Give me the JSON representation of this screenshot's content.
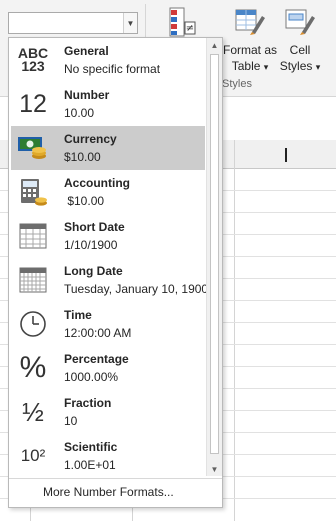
{
  "ribbon": {
    "format_combo_value": "",
    "format_as_table": {
      "line1": "Format as",
      "line2": "Table",
      "caret": "▾"
    },
    "cell_styles": {
      "line1": "Cell",
      "line2": "Styles",
      "caret": "▾"
    },
    "group_label": "Styles"
  },
  "formats": [
    {
      "icon": "general-abc-123-icon",
      "icon_text_top": "ABC",
      "icon_text_bottom": "123",
      "name": "General",
      "example": "No specific format"
    },
    {
      "icon": "number-12-icon",
      "icon_text": "12",
      "name": "Number",
      "example": "10.00"
    },
    {
      "icon": "currency-icon",
      "name": "Currency",
      "example": "$10.00",
      "selected": true
    },
    {
      "icon": "accounting-calculator-icon",
      "name": "Accounting",
      "example": " $10.00"
    },
    {
      "icon": "short-date-calendar-icon",
      "name": "Short Date",
      "example": "1/10/1900"
    },
    {
      "icon": "long-date-calendar-icon",
      "name": "Long Date",
      "example": "Tuesday, January 10, 1900"
    },
    {
      "icon": "time-clock-icon",
      "name": "Time",
      "example": "12:00:00 AM"
    },
    {
      "icon": "percentage-icon",
      "icon_text": "%",
      "name": "Percentage",
      "example": "1000.00%"
    },
    {
      "icon": "fraction-icon",
      "icon_text": "½",
      "name": "Fraction",
      "example": "10"
    },
    {
      "icon": "scientific-icon",
      "icon_text": "10²",
      "name": "Scientific",
      "example": "1.00E+01"
    }
  ],
  "more_formats": "More Number Formats...",
  "colors": {
    "selected_bg": "#cccccc",
    "currency_green": "#2e7d32",
    "currency_blue": "#1f5fa8",
    "coin_gold": "#e0a92a"
  }
}
